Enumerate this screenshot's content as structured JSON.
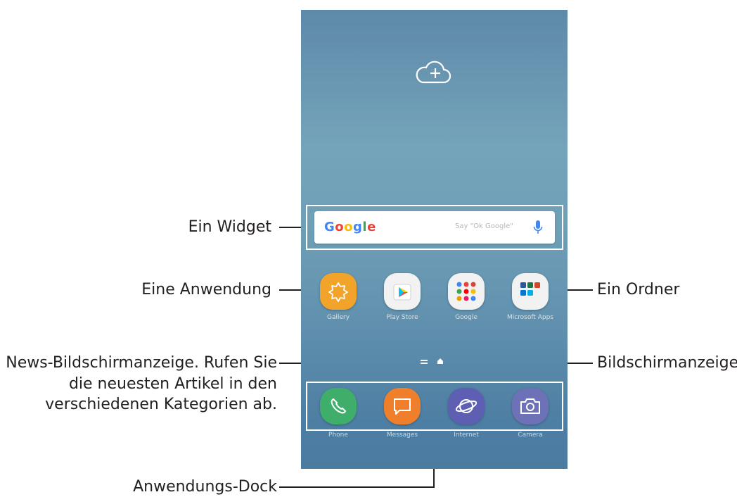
{
  "callouts": {
    "widget": "Ein Widget",
    "app": "Eine Anwendung",
    "folder": "Ein Ordner",
    "news_line1": "News-Bildschirmanzeige. Rufen Sie",
    "news_line2": "die neuesten Artikel in den",
    "news_line3": "verschiedenen Kategorien ab.",
    "screen_indicator": "Bildschirmanzeige",
    "dock": "Anwendungs-Dock"
  },
  "widget": {
    "logo": "Google",
    "hint": "Say \"Ok Google\""
  },
  "apps": [
    {
      "label": "Gallery",
      "icon": "gallery-icon",
      "color": "#f2a42a"
    },
    {
      "label": "Play Store",
      "icon": "play-store-icon",
      "color": "#f2f2f2"
    },
    {
      "label": "Google",
      "icon": "google-folder-icon",
      "color": "#f2f2f2"
    },
    {
      "label": "Microsoft Apps",
      "icon": "microsoft-folder-icon",
      "color": "#f2f2f2"
    }
  ],
  "dock": [
    {
      "label": "Phone",
      "icon": "phone-icon",
      "color": "#3fae6a"
    },
    {
      "label": "Messages",
      "icon": "messages-icon",
      "color": "#f07f2c"
    },
    {
      "label": "Internet",
      "icon": "internet-icon",
      "color": "#5e5fb3"
    },
    {
      "label": "Camera",
      "icon": "camera-icon",
      "color": "#6d72b8"
    }
  ]
}
